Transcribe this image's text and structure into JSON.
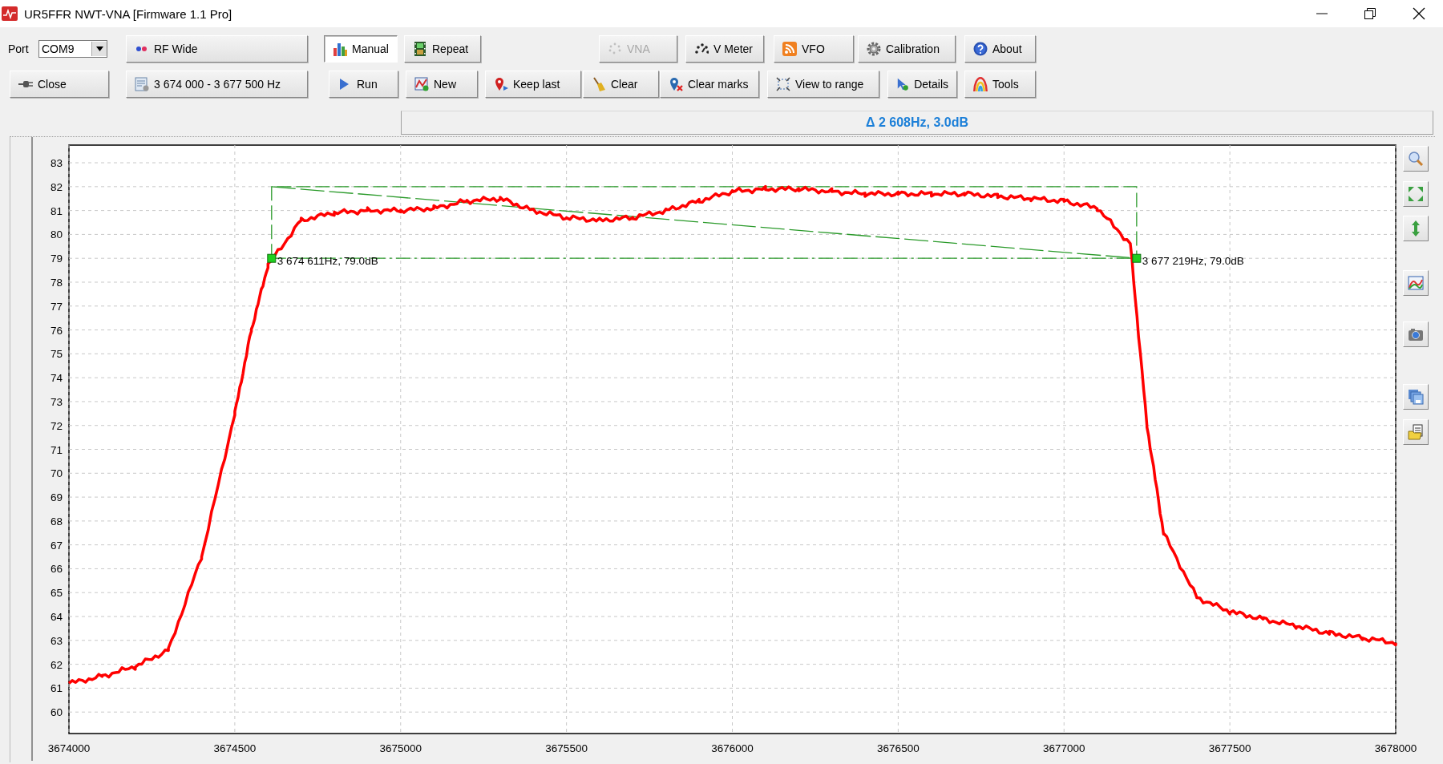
{
  "window": {
    "title": "UR5FFR NWT-VNA [Firmware 1.1 Pro]"
  },
  "toolbar": {
    "rows": [
      {
        "items": [
          {
            "kind": "label",
            "text": "Port"
          },
          {
            "kind": "combo",
            "value": "COM9"
          },
          {
            "kind": "button",
            "label": "RF Wide",
            "pressed": false,
            "disabled": false
          },
          {
            "kind": "button",
            "label": "Manual",
            "pressed": true,
            "disabled": false
          },
          {
            "kind": "button",
            "label": "Repeat",
            "pressed": false,
            "disabled": false
          },
          {
            "kind": "button",
            "label": "VNA",
            "pressed": false,
            "disabled": true
          },
          {
            "kind": "button",
            "label": "V Meter",
            "pressed": false,
            "disabled": false
          },
          {
            "kind": "button",
            "label": "VFO",
            "pressed": false,
            "disabled": false
          },
          {
            "kind": "button",
            "label": "Calibration",
            "pressed": false,
            "disabled": false
          },
          {
            "kind": "button",
            "label": "About",
            "pressed": false,
            "disabled": false
          }
        ]
      },
      {
        "items": [
          {
            "kind": "button",
            "label": "Close",
            "pressed": false,
            "disabled": false
          },
          {
            "kind": "button",
            "label": "3 674 000 - 3 677 500 Hz",
            "pressed": false,
            "disabled": false
          },
          {
            "kind": "button",
            "label": "Run",
            "pressed": false,
            "disabled": false
          },
          {
            "kind": "button",
            "label": "New",
            "pressed": false,
            "disabled": false
          },
          {
            "kind": "button",
            "label": "Keep last",
            "pressed": false,
            "disabled": false
          },
          {
            "kind": "button",
            "label": "Clear",
            "pressed": false,
            "disabled": false
          },
          {
            "kind": "button",
            "label": "Clear marks",
            "pressed": false,
            "disabled": false
          },
          {
            "kind": "button",
            "label": "View to range",
            "pressed": false,
            "disabled": false
          },
          {
            "kind": "button",
            "label": "Details",
            "pressed": false,
            "disabled": false
          },
          {
            "kind": "button",
            "label": "Tools",
            "pressed": false,
            "disabled": false
          }
        ]
      }
    ]
  },
  "readout": {
    "text": "Δ 2 608Hz, 3.0dB"
  },
  "chart": {
    "chart_data": {
      "type": "line",
      "x": [
        3674000,
        3674100,
        3674200,
        3674300,
        3674400,
        3674500,
        3674550,
        3674600,
        3674700,
        3674800,
        3674900,
        3675000,
        3675100,
        3675200,
        3675300,
        3675400,
        3675500,
        3675600,
        3675700,
        3675800,
        3675900,
        3676000,
        3676100,
        3676200,
        3676300,
        3676400,
        3676500,
        3676600,
        3676700,
        3676800,
        3676900,
        3677000,
        3677100,
        3677200,
        3677250,
        3677300,
        3677400,
        3677500,
        3677600,
        3677700,
        3677800,
        3677900,
        3678000
      ],
      "series": [
        {
          "color": "#ff0000",
          "values": [
            61.2,
            61.5,
            61.9,
            62.6,
            66.5,
            72.5,
            76.0,
            78.7,
            80.6,
            80.9,
            81.0,
            81.0,
            81.1,
            81.4,
            81.5,
            81.0,
            80.7,
            80.6,
            80.7,
            81.0,
            81.4,
            81.8,
            81.9,
            81.9,
            81.8,
            81.7,
            81.7,
            81.7,
            81.7,
            81.6,
            81.5,
            81.4,
            81.1,
            79.6,
            72.0,
            67.5,
            64.8,
            64.2,
            63.9,
            63.6,
            63.3,
            63.1,
            62.9
          ]
        }
      ],
      "xlim": [
        3674000,
        3678000
      ],
      "ylim": [
        59.1,
        83.74
      ],
      "xticks": [
        3674000,
        3674500,
        3675000,
        3675500,
        3676000,
        3676500,
        3677000,
        3677500,
        3678000
      ],
      "yticks": [
        60,
        61,
        62,
        63,
        64,
        65,
        66,
        67,
        68,
        69,
        70,
        71,
        72,
        73,
        74,
        75,
        76,
        77,
        78,
        79,
        80,
        81,
        82,
        83
      ],
      "grid": true,
      "annotations": [
        {
          "x": 3674611,
          "y": 79.0,
          "text": "3 674 611Hz, 79.0dB"
        },
        {
          "x": 3677219,
          "y": 79.0,
          "text": "3 677 219Hz, 79.0dB"
        }
      ]
    }
  }
}
